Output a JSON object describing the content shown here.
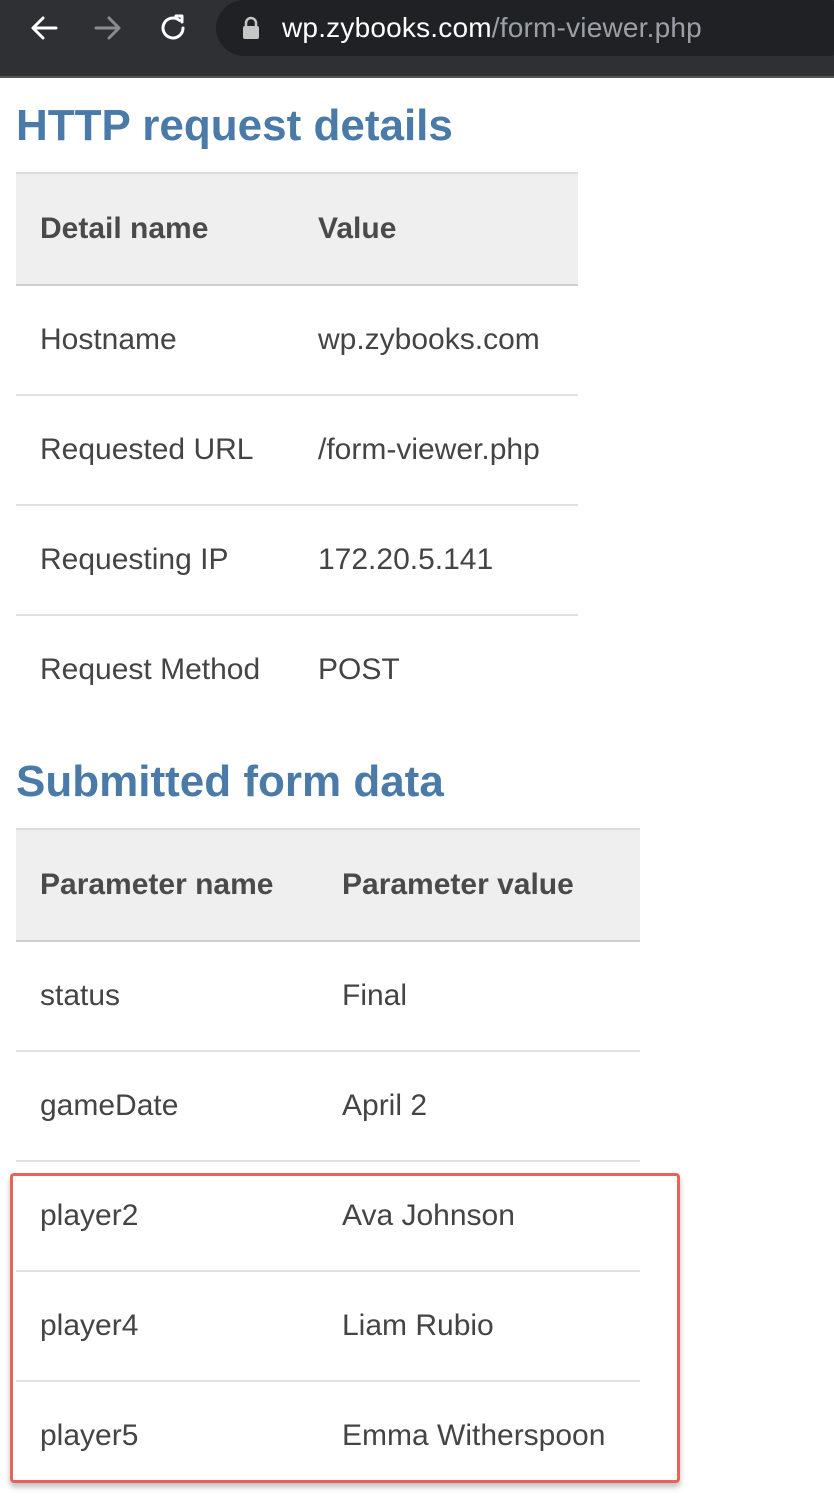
{
  "browser": {
    "url_host": "wp.zybooks.com",
    "url_path": "/form-viewer.php",
    "icons": [
      "back-arrow-icon",
      "forward-arrow-icon",
      "reload-icon",
      "lock-icon"
    ]
  },
  "request_section": {
    "title": "HTTP request details",
    "headers": [
      "Detail name",
      "Value"
    ],
    "rows": [
      [
        "Hostname",
        "wp.zybooks.com"
      ],
      [
        "Requested URL",
        "/form-viewer.php"
      ],
      [
        "Requesting IP",
        "172.20.5.141"
      ],
      [
        "Request Method",
        "POST"
      ]
    ]
  },
  "form_section": {
    "title": "Submitted form data",
    "headers": [
      "Parameter name",
      "Parameter value"
    ],
    "rows": [
      [
        "status",
        "Final"
      ],
      [
        "gameDate",
        "April 2"
      ],
      [
        "player2",
        "Ava Johnson"
      ],
      [
        "player4",
        "Liam Rubio"
      ],
      [
        "player5",
        "Emma Witherspoon"
      ]
    ]
  },
  "colors": {
    "heading": "#4a7aa7",
    "highlight_border": "#e8645a",
    "header_bg": "#efefef",
    "browser_bar": "#2f3033"
  }
}
